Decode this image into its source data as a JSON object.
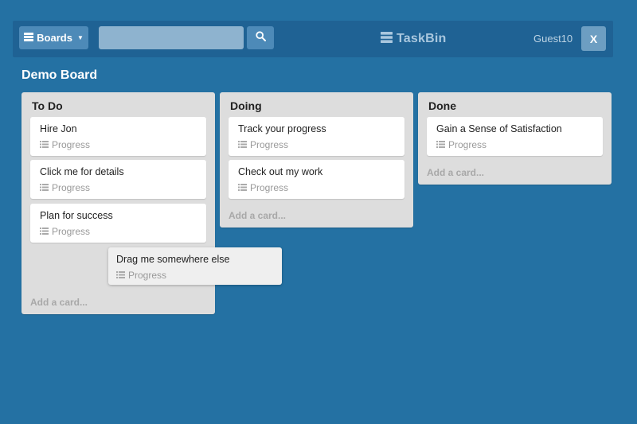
{
  "header": {
    "boards_label": "Boards",
    "search_placeholder": "",
    "brand": "TaskBin",
    "username": "Guest10",
    "close_label": "X"
  },
  "board": {
    "title": "Demo Board"
  },
  "lists": [
    {
      "title": "To Do",
      "cards": [
        {
          "title": "Hire Jon",
          "meta": "Progress"
        },
        {
          "title": "Click me for details",
          "meta": "Progress"
        },
        {
          "title": "Plan for success",
          "meta": "Progress"
        }
      ],
      "add_label": "Add a card..."
    },
    {
      "title": "Doing",
      "cards": [
        {
          "title": "Track your progress",
          "meta": "Progress"
        },
        {
          "title": "Check out my work",
          "meta": "Progress"
        }
      ],
      "add_label": "Add a card..."
    },
    {
      "title": "Done",
      "cards": [
        {
          "title": "Gain a Sense of Satisfaction",
          "meta": "Progress"
        }
      ],
      "add_label": "Add a card..."
    }
  ],
  "dragging_card": {
    "title": "Drag me somewhere else",
    "meta": "Progress"
  },
  "colors": {
    "background": "#2471a3",
    "topbar": "#1f6294",
    "list": "#dddddd",
    "card": "#ffffff"
  },
  "icons": {
    "boards": "boards-icon",
    "search": "search-icon",
    "brand": "taskbin-logo-icon",
    "progress": "list-icon"
  }
}
